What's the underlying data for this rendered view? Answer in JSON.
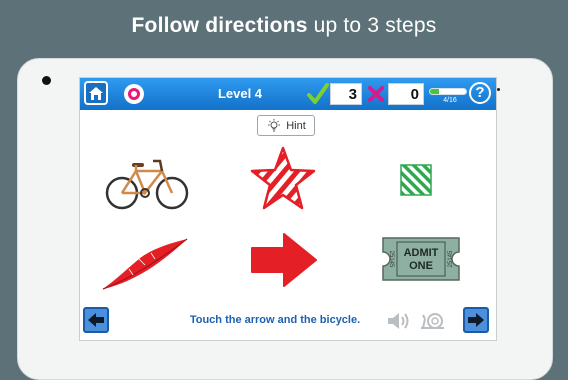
{
  "banner": {
    "bold": "Follow directions",
    "rest": "up to 3 steps"
  },
  "topbar": {
    "level": "Level 4",
    "correct": "3",
    "wrong": "0",
    "progress_label": "4/16",
    "progress": 0.25,
    "help": "?"
  },
  "hint": {
    "label": "Hint"
  },
  "items": [
    {
      "name": "bicycle",
      "icon": "bicycle-icon"
    },
    {
      "name": "striped star",
      "icon": "star-icon"
    },
    {
      "name": "striped square",
      "icon": "square-icon"
    },
    {
      "name": "red feather",
      "icon": "feather-icon"
    },
    {
      "name": "red arrow",
      "icon": "arrow-icon"
    },
    {
      "name": "admit one ticket",
      "icon": "ticket-icon",
      "ticket_text_top": "ADMIT",
      "ticket_text_bottom": "ONE",
      "ticket_num_left": "25145",
      "ticket_num_right": "25145"
    }
  ],
  "instruction": "Touch the arrow and the bicycle.",
  "colors": {
    "accent": "#1b75d0",
    "red": "#e41f26",
    "green": "#2fa84f",
    "correct": "#7dd12c",
    "wrong": "#d81b8c"
  }
}
